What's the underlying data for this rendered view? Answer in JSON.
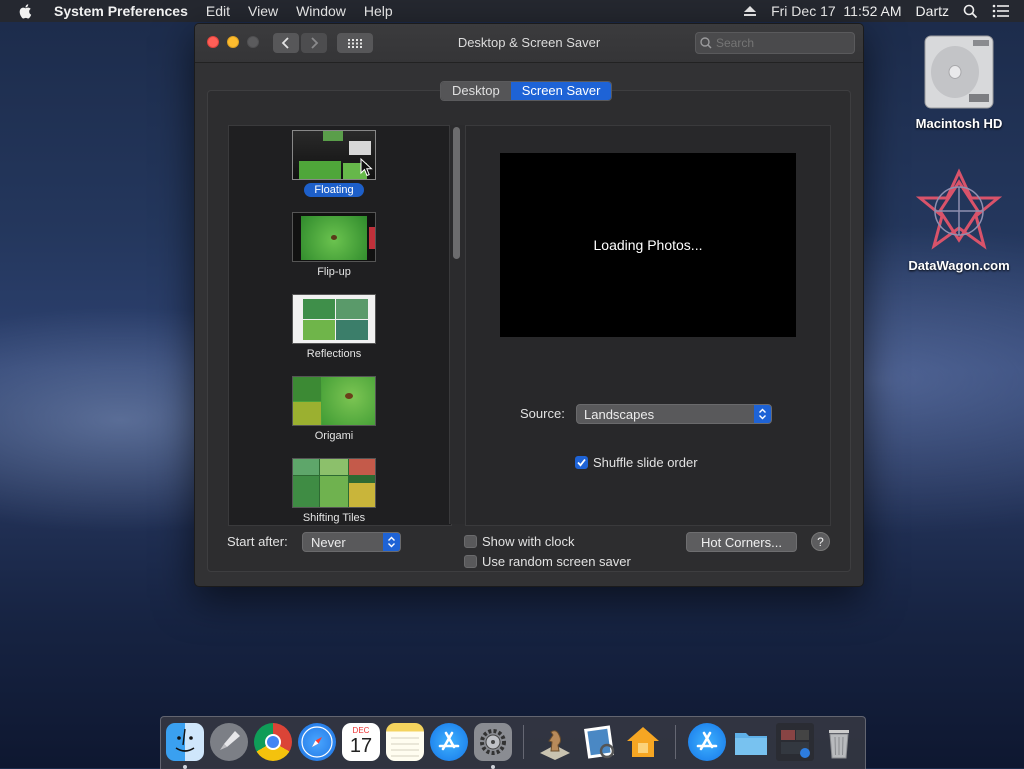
{
  "menubar": {
    "app": "System Preferences",
    "items": [
      "Edit",
      "View",
      "Window",
      "Help"
    ],
    "datetime": "Fri Dec 17  11:52 AM",
    "user": "Dartz"
  },
  "desktop": {
    "hd_label": "Macintosh HD",
    "datawagon_label": "DataWagon.com"
  },
  "window": {
    "title": "Desktop & Screen Saver",
    "search_placeholder": "Search",
    "tabs": [
      {
        "label": "Desktop",
        "active": false
      },
      {
        "label": "Screen Saver",
        "active": true
      }
    ],
    "savers": [
      {
        "name": "Floating",
        "selected": true
      },
      {
        "name": "Flip-up",
        "selected": false
      },
      {
        "name": "Reflections",
        "selected": false
      },
      {
        "name": "Origami",
        "selected": false
      },
      {
        "name": "Shifting Tiles",
        "selected": false
      }
    ],
    "preview_text": "Loading Photos...",
    "source_label": "Source:",
    "source_value": "Landscapes",
    "shuffle_label": "Shuffle slide order",
    "shuffle_checked": true,
    "start_after_label": "Start after:",
    "start_after_value": "Never",
    "show_clock_label": "Show with clock",
    "random_label": "Use random screen saver",
    "hot_corners_label": "Hot Corners...",
    "help_label": "?"
  },
  "dock": {
    "calendar_month": "DEC",
    "calendar_day": "17",
    "apps": [
      "finder-icon",
      "launchpad-icon",
      "chrome-icon",
      "safari-icon",
      "calendar-icon",
      "notes-icon",
      "app-store-icon",
      "system-preferences-icon",
      "chess-icon",
      "preview-icon",
      "home-icon",
      "app-store-downloads-icon",
      "folder-icon",
      "screenshot-icon",
      "trash-icon"
    ]
  },
  "colors": {
    "accent": "#1e63d6",
    "window_bg": "#323234",
    "list_bg": "#1f1f21"
  }
}
